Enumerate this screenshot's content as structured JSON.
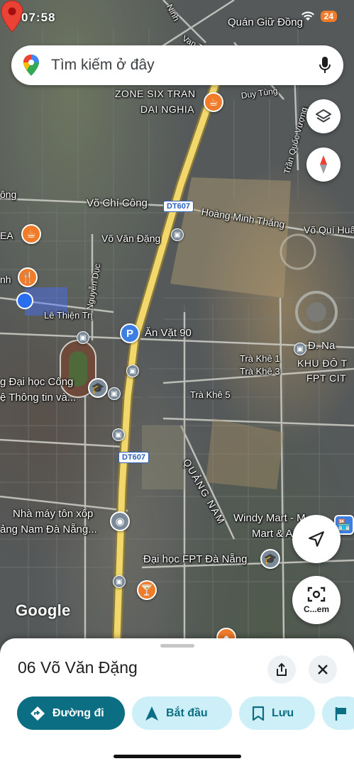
{
  "status_bar": {
    "time": "07:58",
    "battery": "24"
  },
  "search": {
    "placeholder": "Tìm kiếm ở đây"
  },
  "map": {
    "labels": {
      "quan_giu_dong": "Quán Giữ Đồng",
      "zone_six": "ZONE SIX TRAN",
      "dai_nghia": "DAI NGHIA",
      "vo_chi_cong": "Võ Chí Công",
      "vo_van_dang": "Võ Văn Đặng",
      "hoang_minh_thang": "Hoàng Minh Thắng",
      "vo_qui_huan": "Võ Quí Huân",
      "nguyen_duc": "Nguyễn Dục",
      "le_thien_tri": "Lê Thiện Trị",
      "an_vat_90": "Ăn Vặt 90",
      "tra_khe_1": "Trà Khê 1",
      "tra_khe_3": "Trà Khê 3",
      "tra_khe_5": "Trà Khê 5",
      "d_na": "Đ. Na",
      "khu_do_thi": "KHU ĐÔ T",
      "fpt_city": "FPT CIT",
      "dh_cong": "g Đại học Công",
      "thong_tin": "ệ Thông tin và...",
      "quang_nam": "QUẢNG NAM",
      "nha_may": "Nhà máy tôn xốp",
      "nam_da_nang": "ảng Nam Đà Nẵng...",
      "windy_mart": "Windy Mart - M",
      "mart_apa": "Mart & Apa",
      "dai_hoc_fpt": "Đại học FPT Đà Nẵng",
      "tran_quoc_vuong": "Trần Quốc Vượng",
      "duy_tung": "Duy Tùng",
      "ong": "ông",
      "tea": "EA",
      "nh": "nh",
      "van": "Van T",
      "ninh": "Ninh"
    },
    "road_shield": "DT607",
    "watermark": "Google"
  },
  "lens_button": {
    "label": "C...em"
  },
  "place": {
    "title": "06 Võ Văn Đặng",
    "actions": {
      "directions": "Đường đi",
      "start": "Bắt đầu",
      "save": "Lưu"
    }
  }
}
